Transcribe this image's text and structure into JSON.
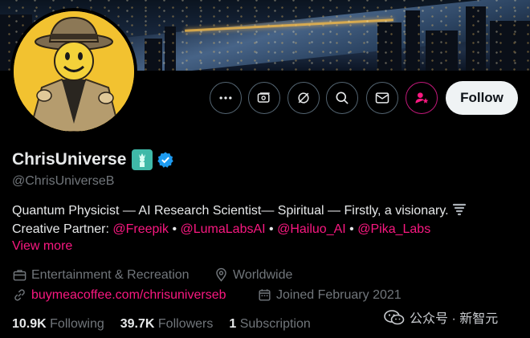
{
  "profile": {
    "display_name": "ChrisUniverse",
    "handle": "@ChrisUniverseB",
    "bio_line1": "Quantum Physicist — AI Research Scientist— Spiritual — Firstly, a visionary.",
    "bio_line2_prefix": "Creative Partner:",
    "partners": [
      "@Freepik",
      "@LumaLabsAI",
      "@Hailuo_AI",
      "@Pika_Labs"
    ],
    "separator": "•",
    "view_more": "View more",
    "category": "Entertainment & Recreation",
    "location": "Worldwide",
    "website": "buymeacoffee.com/chrisuniverseb",
    "joined": "Joined February 2021"
  },
  "stats": {
    "following_count": "10.9K",
    "following_label": "Following",
    "followers_count": "39.7K",
    "followers_label": "Followers",
    "subscription_count": "1",
    "subscription_label": "Subscription"
  },
  "actions": {
    "follow_label": "Follow",
    "icons": [
      "more-icon",
      "subscribe-icon",
      "grok-icon",
      "search-icon",
      "message-icon",
      "notify-user-icon"
    ]
  },
  "watermark": {
    "text": "公众号 · 新智元"
  },
  "colors": {
    "accent": "#f91880",
    "background": "#000000",
    "verified": "#1d9bf0",
    "avatar_bg": "#f2c230"
  }
}
